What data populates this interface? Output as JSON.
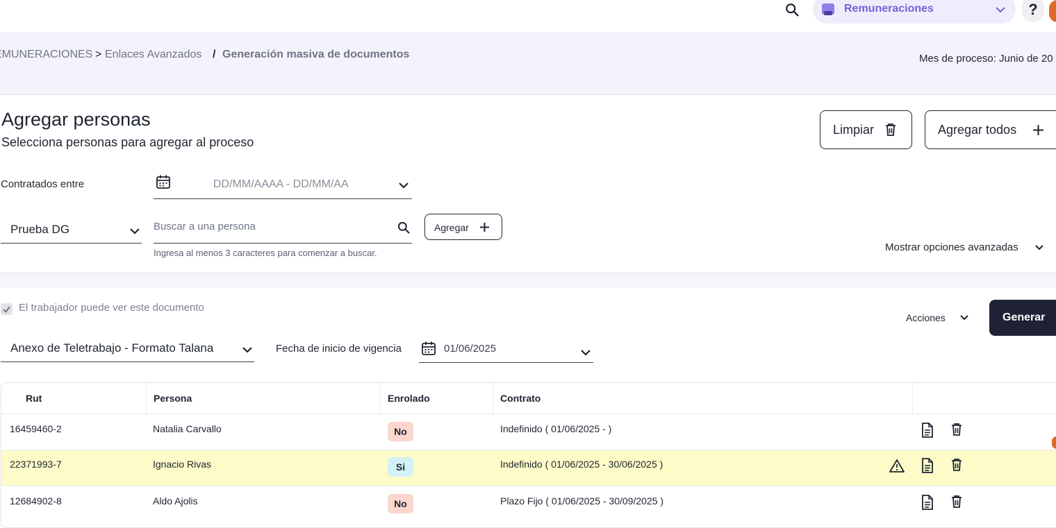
{
  "topbar": {
    "module_label": "Remuneraciones",
    "help_label": "?"
  },
  "breadcrumb": {
    "root": "EMUNERACIONES",
    "sep1": ">",
    "parent": "Enlaces Avanzados",
    "sep2": "/",
    "current": "Generación masiva de documentos"
  },
  "process_month": "Mes de proceso: Junio de 20",
  "header": {
    "title": "Agregar personas",
    "subtitle": "Selecciona personas para agregar al proceso",
    "clear_label": "Limpiar",
    "add_all_label": "Agregar todos"
  },
  "filters": {
    "hired_between_label": "Contratados entre",
    "date_range_placeholder": "DD/MM/AAAA - DD/MM/AA",
    "group_value": "Prueba DG",
    "search_placeholder": "Buscar a una persona",
    "search_hint": "Ingresa al menos 3 caracteres para comenzar a buscar.",
    "add_label": "Agregar",
    "advanced_label": "Mostrar opciones avanzadas"
  },
  "document": {
    "visible_label": "El trabajador puede ver este documento",
    "visible_checked": true,
    "actions_label": "Acciones",
    "generate_label": "Generar",
    "template_value": "Anexo de Teletrabajo - Formato Talana",
    "start_date_label": "Fecha de inicio de vigencia",
    "start_date_value": "01/06/2025"
  },
  "table": {
    "headers": [
      "Rut",
      "Persona",
      "Enrolado",
      "Contrato"
    ],
    "rows": [
      {
        "rut": "16459460-2",
        "persona": "Natalia Carvallo",
        "enrolado": "No",
        "contrato": "Indefinido ( 01/06/2025 - )",
        "warning": false
      },
      {
        "rut": "22371993-7",
        "persona": "Ignacio Rivas",
        "enrolado": "Si",
        "contrato": "Indefinido ( 01/06/2025 - 30/06/2025 )",
        "warning": true
      },
      {
        "rut": "12684902-8",
        "persona": "Aldo Ajolis",
        "enrolado": "No",
        "contrato": "Plazo Fijo ( 01/06/2025 - 30/09/2025 )",
        "warning": false
      }
    ]
  },
  "colors": {
    "accent": "#7461d9",
    "warning_row": "#fdfbc8",
    "badge_no": "#fbd6cf",
    "badge_si": "#d3f1f6",
    "primary_button": "#1f2235"
  }
}
